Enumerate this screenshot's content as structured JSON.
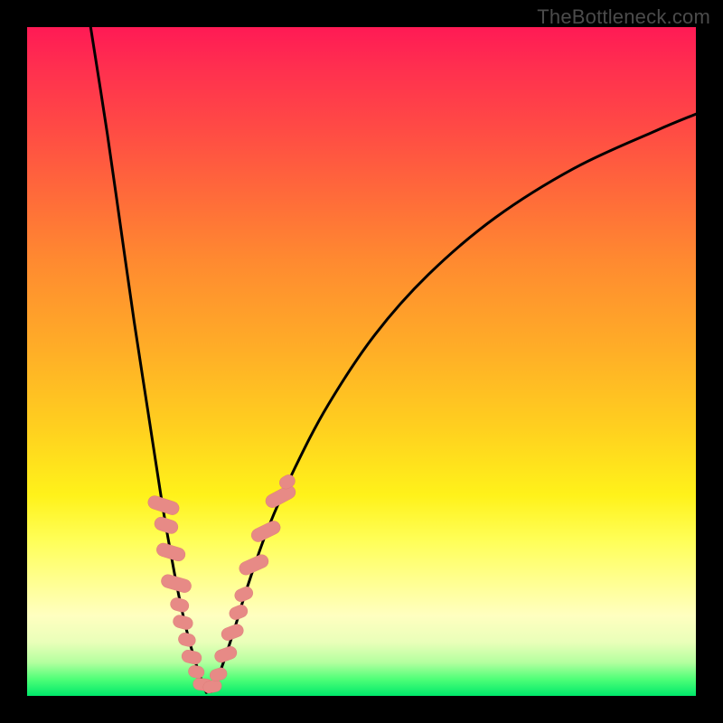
{
  "watermark": "TheBottleneck.com",
  "colors": {
    "frame": "#000000",
    "curve": "#000000",
    "marker_fill": "#e78a86",
    "marker_stroke": "#d77571"
  },
  "chart_data": {
    "type": "line",
    "title": "",
    "xlabel": "",
    "ylabel": "",
    "xlim": [
      0,
      100
    ],
    "ylim": [
      0,
      100
    ],
    "notes": "V-shaped bottleneck curve with vertical-gradient background (red=high bottleneck at top, green=low at bottom). X is an implicit hardware scale; Y is bottleneck magnitude. Two curve branches meet near x≈26.5 at y≈0.",
    "series": [
      {
        "name": "left-branch",
        "x": [
          9.5,
          12,
          14,
          16,
          18,
          20,
          21,
          22,
          23,
          24,
          25,
          26,
          26.8
        ],
        "y": [
          100,
          84,
          70,
          56,
          43,
          30,
          24,
          18.5,
          13.5,
          9.2,
          5.6,
          2.6,
          0.5
        ]
      },
      {
        "name": "right-branch",
        "x": [
          27.5,
          29,
          31,
          33,
          36,
          40,
          45,
          52,
          60,
          70,
          82,
          94,
          100
        ],
        "y": [
          0.6,
          4.0,
          10.0,
          16.5,
          25.0,
          34.0,
          43.5,
          54.0,
          63.0,
          71.5,
          79.0,
          84.5,
          87.0
        ]
      }
    ],
    "markers": {
      "name": "highlight-points",
      "comment": "Coral lozenge markers clustered on both branches in the lower (yellow-green) band, roughly y ∈ [2, 32].",
      "points": [
        {
          "x": 20.4,
          "y": 28.5,
          "w": 2.0,
          "h": 4.8,
          "rot": -72
        },
        {
          "x": 20.8,
          "y": 25.5,
          "w": 2.0,
          "h": 3.6,
          "rot": -72
        },
        {
          "x": 21.5,
          "y": 21.5,
          "w": 2.0,
          "h": 4.4,
          "rot": -73
        },
        {
          "x": 22.3,
          "y": 16.8,
          "w": 2.0,
          "h": 4.6,
          "rot": -74
        },
        {
          "x": 22.8,
          "y": 13.6,
          "w": 1.9,
          "h": 2.8,
          "rot": -74
        },
        {
          "x": 23.3,
          "y": 11.0,
          "w": 1.9,
          "h": 3.0,
          "rot": -75
        },
        {
          "x": 23.9,
          "y": 8.4,
          "w": 1.9,
          "h": 2.6,
          "rot": -76
        },
        {
          "x": 24.6,
          "y": 5.8,
          "w": 1.9,
          "h": 3.0,
          "rot": -77
        },
        {
          "x": 25.3,
          "y": 3.6,
          "w": 1.8,
          "h": 2.4,
          "rot": -79
        },
        {
          "x": 26.3,
          "y": 1.7,
          "w": 1.8,
          "h": 3.0,
          "rot": -83
        },
        {
          "x": 27.7,
          "y": 1.4,
          "w": 1.8,
          "h": 2.8,
          "rot": 78
        },
        {
          "x": 28.6,
          "y": 3.2,
          "w": 1.8,
          "h": 2.6,
          "rot": 73
        },
        {
          "x": 29.7,
          "y": 6.2,
          "w": 1.9,
          "h": 3.4,
          "rot": 70
        },
        {
          "x": 30.7,
          "y": 9.5,
          "w": 1.9,
          "h": 3.4,
          "rot": 69
        },
        {
          "x": 31.6,
          "y": 12.5,
          "w": 1.9,
          "h": 2.8,
          "rot": 68
        },
        {
          "x": 32.4,
          "y": 15.2,
          "w": 1.9,
          "h": 2.8,
          "rot": 67
        },
        {
          "x": 33.9,
          "y": 19.6,
          "w": 2.0,
          "h": 4.6,
          "rot": 66
        },
        {
          "x": 35.7,
          "y": 24.6,
          "w": 2.0,
          "h": 4.6,
          "rot": 64
        },
        {
          "x": 37.9,
          "y": 29.8,
          "w": 2.0,
          "h": 4.8,
          "rot": 62
        },
        {
          "x": 38.9,
          "y": 32.0,
          "w": 1.9,
          "h": 2.4,
          "rot": 61
        }
      ]
    }
  }
}
